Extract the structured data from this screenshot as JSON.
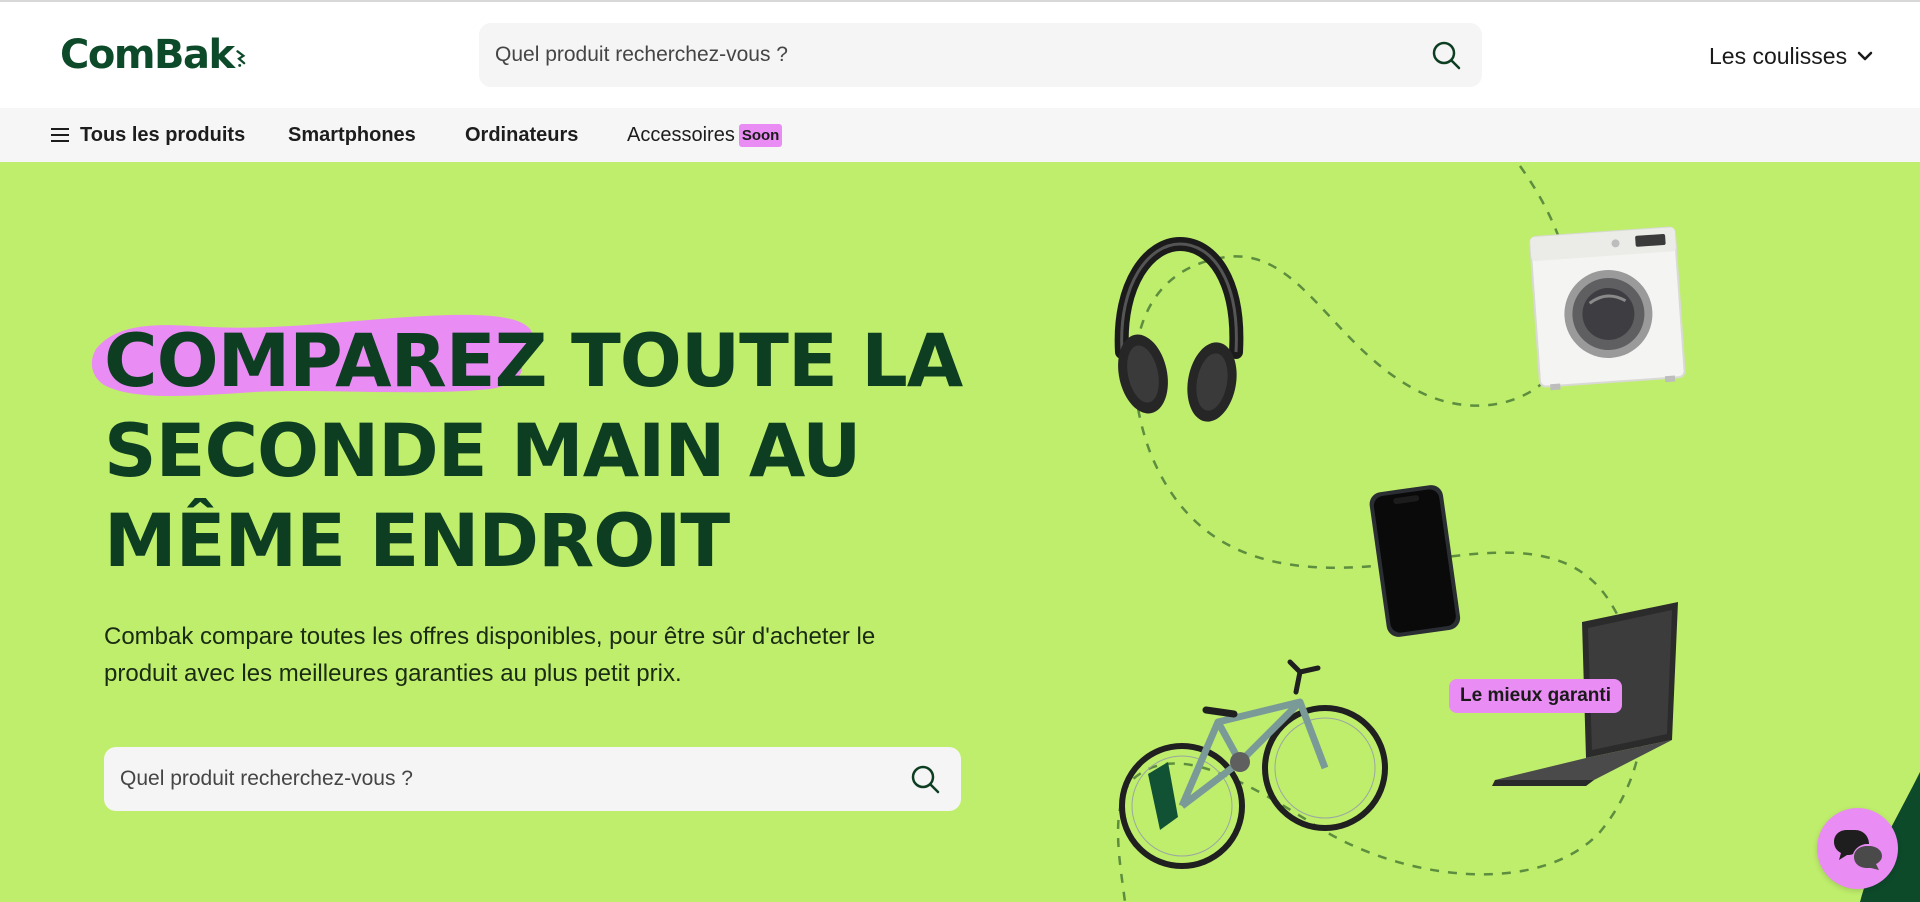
{
  "header": {
    "logo_text": "ComBak",
    "search_placeholder": "Quel produit recherchez-vous ?",
    "menu_label": "Les coulisses"
  },
  "nav": {
    "items": [
      {
        "label": "Tous les produits",
        "icon": "menu-icon"
      },
      {
        "label": "Smartphones"
      },
      {
        "label": "Ordinateurs"
      },
      {
        "label": "Accessoires",
        "badge": "Soon"
      }
    ]
  },
  "hero": {
    "title_highlight": "COMPAREZ",
    "title_rest_1": "TOUTE LA",
    "title_line_2": "SECONDE MAIN AU",
    "title_line_3": "MÊME ENDROIT",
    "description": "Combak compare toutes les offres disponibles, pour être sûr d'acheter le produit avec les meilleures garanties au plus petit prix.",
    "search_placeholder": "Quel produit recherchez-vous ?",
    "badge": "Le mieux garanti",
    "products": [
      "headphones",
      "washing-machine",
      "smartphone",
      "laptop",
      "bicycle"
    ]
  },
  "chat": {
    "icon": "chat-bubbles-icon"
  },
  "colors": {
    "brand_dark_green": "#0d3e22",
    "hero_background": "#bfee6c",
    "accent_pink": "#e98cf3",
    "nav_background": "#f6f6f6",
    "search_background": "#f5f5f5"
  }
}
